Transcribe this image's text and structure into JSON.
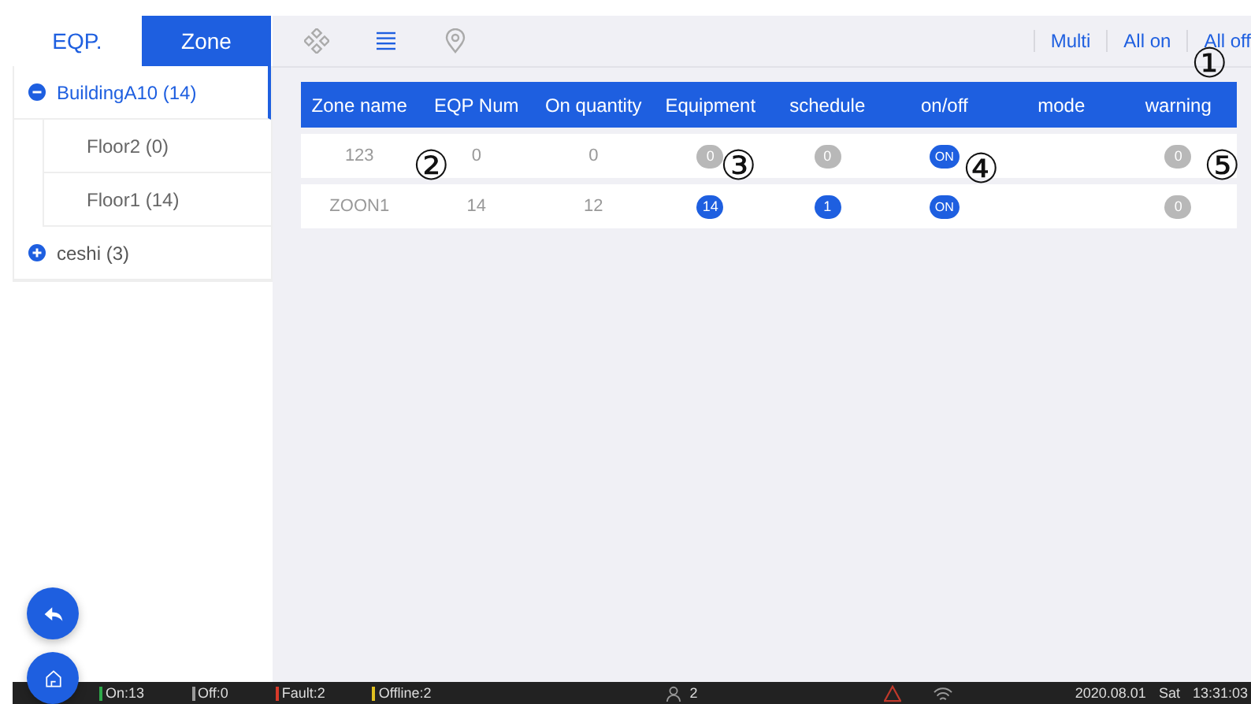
{
  "tabs": [
    {
      "label": "EQP.",
      "selected": false
    },
    {
      "label": "Zone",
      "selected": true
    }
  ],
  "toolbar_actions": [
    "Multi",
    "All on",
    "All off"
  ],
  "tree": [
    {
      "label": "BuildingA10 (14)",
      "expanded": true,
      "selected": true,
      "children": [
        {
          "label": "Floor2 (0)",
          "selected": false
        },
        {
          "label": "Floor1 (14)",
          "selected": false
        }
      ]
    },
    {
      "label": "ceshi (3)",
      "expanded": false,
      "selected": false
    }
  ],
  "table": {
    "columns": [
      "Zone name",
      "EQP Num",
      "On quantity",
      "Equipment",
      "schedule",
      "on/off",
      "mode",
      "warning"
    ],
    "rows": [
      {
        "zone_name": "123",
        "eqp_num": "0",
        "on_quantity": "0",
        "equipment": {
          "value": "0",
          "active": false
        },
        "schedule": {
          "value": "0",
          "active": false
        },
        "on_off": {
          "label": "ON",
          "on": true
        },
        "warning": {
          "value": "0",
          "active": false
        }
      },
      {
        "zone_name": "ZOON1",
        "eqp_num": "14",
        "on_quantity": "12",
        "equipment": {
          "value": "14",
          "active": true
        },
        "schedule": {
          "value": "1",
          "active": true
        },
        "on_off": {
          "label": "ON",
          "on": true
        },
        "warning": {
          "value": "0",
          "active": false
        }
      }
    ]
  },
  "callouts": [
    "①",
    "②",
    "③",
    "④",
    "⑤"
  ],
  "status_bar": {
    "counts": [
      {
        "label": "On:13",
        "color": "#2ea84a"
      },
      {
        "label": "Off:0",
        "color": "#9a9a9a"
      },
      {
        "label": "Fault:2",
        "color": "#d83a2a"
      },
      {
        "label": "Offline:2",
        "color": "#e0c020"
      }
    ],
    "users": "2",
    "date": "2020.08.01",
    "weekday": "Sat",
    "time": "13:31:03"
  }
}
